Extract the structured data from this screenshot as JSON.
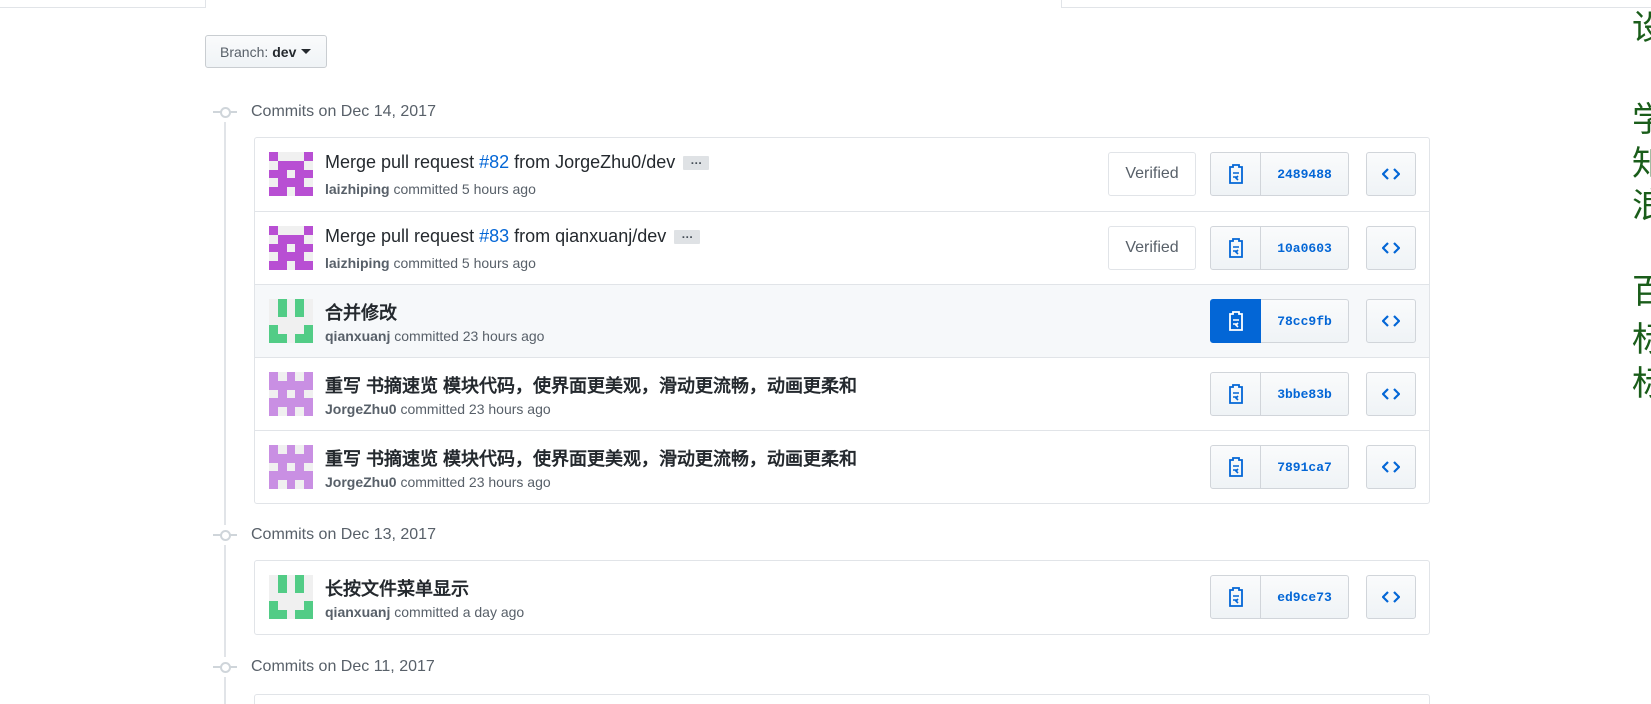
{
  "branch": {
    "label": "Branch:",
    "value": "dev"
  },
  "groups": [
    {
      "title": "Commits on Dec 14, 2017",
      "commits": [
        {
          "msg_pre": "Merge pull request ",
          "pr": "#82",
          "msg_post": " from JorgeZhu0/dev",
          "author": "laizhiping",
          "time": "committed 5 hours ago",
          "verified": "Verified",
          "sha": "2489488"
        },
        {
          "msg_pre": "Merge pull request ",
          "pr": "#83",
          "msg_post": " from qianxuanj/dev",
          "author": "laizhiping",
          "time": "committed 5 hours ago",
          "verified": "Verified",
          "sha": "10a0603"
        },
        {
          "msg": "合并修改",
          "author": "qianxuanj",
          "time": "committed 23 hours ago",
          "sha": "78cc9fb"
        },
        {
          "msg": "重写 书摘速览 模块代码，使界面更美观，滑动更流畅，动画更柔和",
          "author": "JorgeZhu0",
          "time": "committed 23 hours ago",
          "sha": "3bbe83b"
        },
        {
          "msg": "重写 书摘速览 模块代码，使界面更美观，滑动更流畅，动画更柔和",
          "author": "JorgeZhu0",
          "time": "committed 23 hours ago",
          "sha": "7891ca7"
        }
      ]
    },
    {
      "title": "Commits on Dec 13, 2017",
      "commits": [
        {
          "msg": "长按文件菜单显示",
          "author": "qianxuanj",
          "time": "committed a day ago",
          "sha": "ed9ce73"
        }
      ]
    },
    {
      "title": "Commits on Dec 11, 2017"
    }
  ],
  "ellipsis": "…",
  "side_chars": [
    "设",
    "学",
    "知",
    "浪",
    "百",
    "标",
    "标"
  ],
  "colors": {
    "link": "#0366d6",
    "avatar_purple": "#b84fd3",
    "avatar_green": "#52cc86",
    "avatar_lilac": "#c98fe3"
  }
}
